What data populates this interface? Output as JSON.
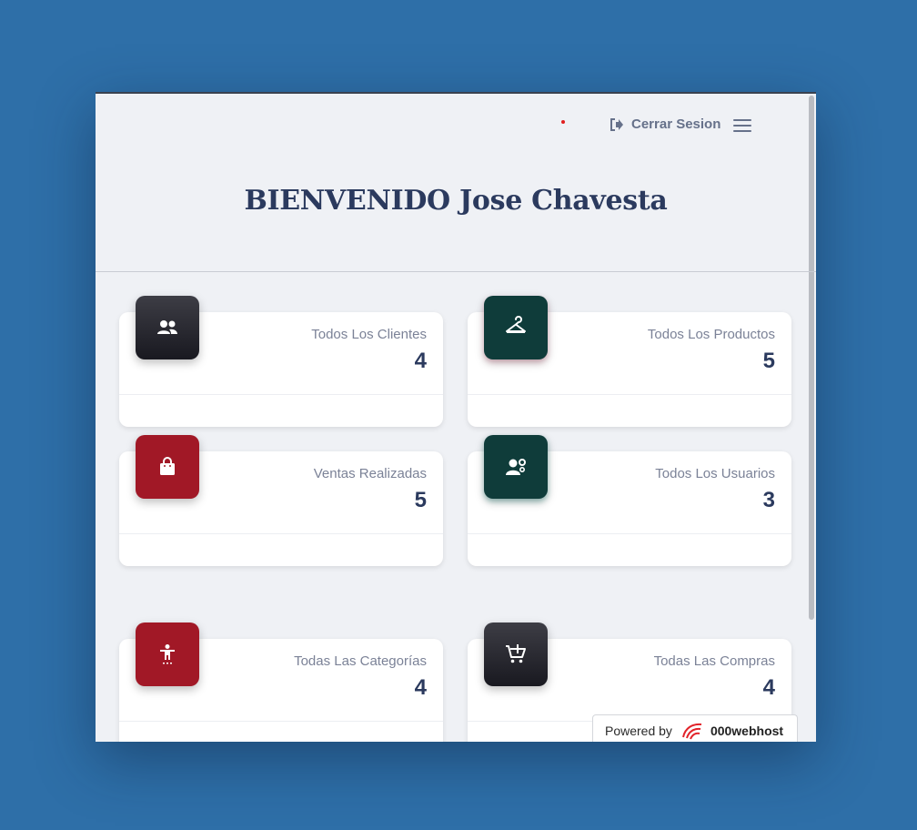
{
  "header": {
    "logout_label": "Cerrar Sesion"
  },
  "page": {
    "title": "BIENVENIDO Jose Chavesta"
  },
  "cards": [
    {
      "label": "Todos Los Clientes",
      "value": "4",
      "icon": "users-icon",
      "color": "#2c2c33"
    },
    {
      "label": "Todos Los Productos",
      "value": "5",
      "icon": "hanger-icon",
      "color": "#0f3c3a"
    },
    {
      "label": "Ventas Realizadas",
      "value": "5",
      "icon": "shopping-bag-icon",
      "color": "#a11826"
    },
    {
      "label": "Todos Los Usuarios",
      "value": "3",
      "icon": "user-cog-icon",
      "color": "#0f3c3a"
    },
    {
      "label": "Todas Las Categorías",
      "value": "4",
      "icon": "person-icon",
      "color": "#a11826"
    },
    {
      "label": "Todas Las Compras",
      "value": "4",
      "icon": "cart-plus-icon",
      "color": "#2c2c33"
    }
  ],
  "footer_badge": {
    "prefix": "Powered by",
    "brand": "000webhost"
  }
}
